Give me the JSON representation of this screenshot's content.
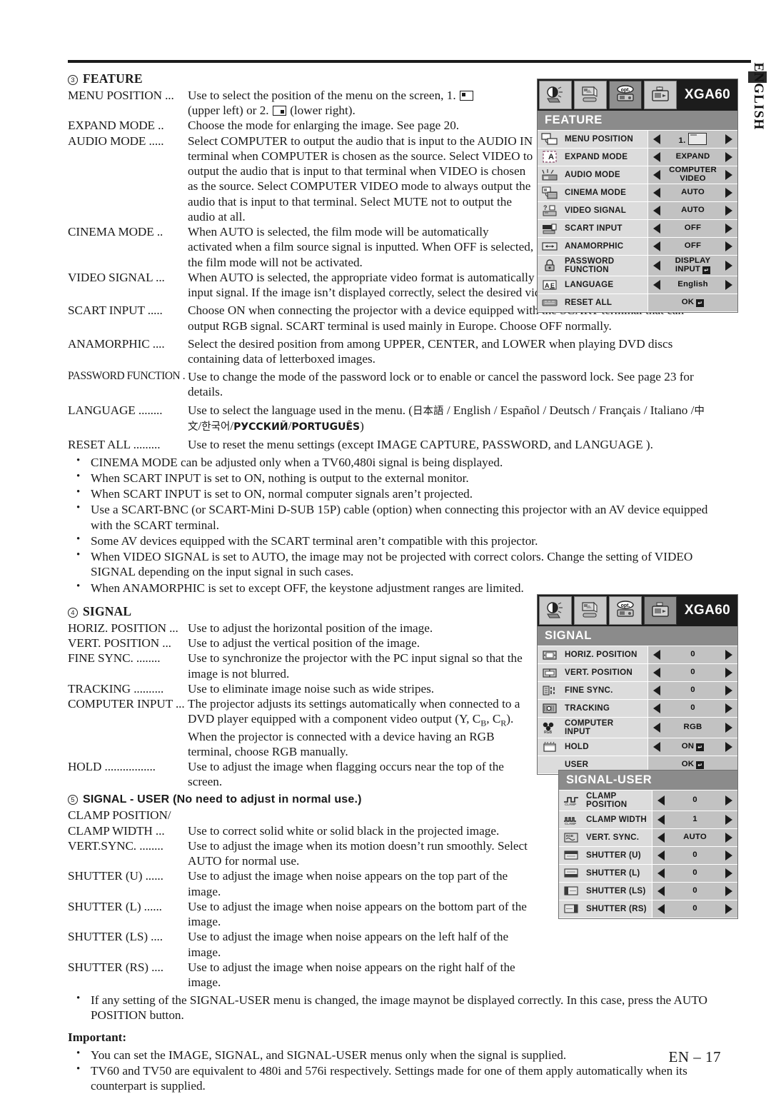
{
  "page": {
    "footer": "EN – 17",
    "side_tab_label": "ENGLISH"
  },
  "sections": {
    "feature": {
      "number": "3",
      "title": "FEATURE",
      "items": [
        {
          "term": "MENU POSITION ...",
          "desc_pre": "Use to select the position of the menu on the screen,  1.",
          "desc_mid": "(upper left) or 2.",
          "desc_post": "(lower right)."
        },
        {
          "term": "EXPAND MODE ..",
          "desc": "Choose the mode for enlarging the image. See page 20."
        },
        {
          "term": "AUDIO MODE .....",
          "desc": "Select COMPUTER to output the audio that is input to the AUDIO IN terminal when COMPUTER is chosen as the source. Select VIDEO to output the audio that is input to that terminal when VIDEO is chosen as the source. Select COMPUTER VIDEO mode to always output the audio that is input to that terminal. Select MUTE not to output the audio at all."
        },
        {
          "term": "CINEMA MODE ..",
          "desc": "When AUTO is selected, the film mode will be automatically activated when a film source signal is inputted. When OFF is selected, the film mode will not be activated."
        },
        {
          "term": "VIDEO SIGNAL ...",
          "desc": "When AUTO is selected, the appropriate video format is automatically selected depending on the input signal. If the image isn’t displayed correctly, select the desired video format manually."
        },
        {
          "term": "SCART INPUT .....",
          "desc": "Choose ON when connecting the projector with a device equipped with the SCART terminal that can output RGB signal. SCART terminal is used mainly in Europe. Choose OFF normally."
        },
        {
          "term": "ANAMORPHIC ....",
          "desc": "Select the desired position from among UPPER, CENTER, and LOWER when playing DVD discs containing data of letterboxed images."
        },
        {
          "term": "PASSWORD FUNCTION .",
          "desc": "Use to change the mode of the password lock or to enable or cancel the password lock. See page 23 for details."
        },
        {
          "term": "LANGUAGE ........",
          "desc_a": "Use to select the language used in the menu. (",
          "lang_jp": "日本語",
          "desc_b": " / English / Español / Deutsch / Français / Italiano /",
          "lang_cn": "中文",
          "lang_kr": "한국어",
          "lang_ru": "РУССКИЙ",
          "lang_pt": "PORTUGUÊS",
          "desc_c": ")"
        },
        {
          "term": "RESET ALL .........",
          "desc": "Use to reset the menu settings (except IMAGE CAPTURE, PASSWORD, and LANGUAGE )."
        }
      ],
      "bullets": [
        "CINEMA MODE can be adjusted only when a TV60,480i signal is being displayed.",
        "When SCART INPUT is set to ON, nothing is output to the external monitor.",
        "When SCART INPUT is set to ON, normal computer signals aren’t projected.",
        "Use a SCART-BNC (or SCART-Mini D-SUB 15P) cable (option) when connecting this projector with an AV device equipped with the SCART terminal.",
        "Some AV devices equipped with the SCART terminal aren’t compatible with this projector.",
        "When VIDEO SIGNAL is set to AUTO, the image may not be projected with correct colors. Change the setting of VIDEO SIGNAL depending on the input signal in such cases.",
        "When ANAMORPHIC is set to except OFF, the keystone adjustment ranges are limited."
      ]
    },
    "signal": {
      "number": "4",
      "title": "SIGNAL",
      "items": [
        {
          "term": "HORIZ. POSITION ...",
          "desc": "Use to adjust the horizontal position of the image."
        },
        {
          "term": "VERT. POSITION  ...",
          "desc": "Use to adjust the vertical position of the image."
        },
        {
          "term": "FINE SYNC. ........",
          "desc": "Use to synchronize the projector with the PC input signal so that the image is not blurred."
        },
        {
          "term": "TRACKING ..........",
          "desc": "Use to eliminate image noise such as wide stripes."
        },
        {
          "term": "COMPUTER INPUT ...",
          "desc_a": "The projector adjusts its settings automatically when connected to a DVD player equipped with a component video output (Y, C",
          "sub1": "B",
          "desc_b": ", C",
          "sub2": "R",
          "desc_c": "). When the projector is connected with a device having an RGB terminal, choose RGB manually."
        },
        {
          "term": "HOLD .................",
          "desc": "Use to adjust the image when flagging occurs near the top of the screen."
        }
      ]
    },
    "signal_user": {
      "number": "5",
      "title": "SIGNAL - USER (No need to adjust in normal use.)",
      "items": [
        {
          "term": "CLAMP POSITION/",
          "desc": ""
        },
        {
          "term": "CLAMP WIDTH ...",
          "desc": "Use to correct solid white or solid black in the projected image."
        },
        {
          "term": "VERT.SYNC. ........",
          "desc": "Use to adjust the image when its motion doesn’t run smoothly. Select AUTO for normal use."
        },
        {
          "term": "SHUTTER (U) ......",
          "desc": "Use to adjust the image when noise appears on the top part of the image."
        },
        {
          "term": "SHUTTER (L) ......",
          "desc": "Use to adjust the image when noise appears on the bottom part of the image."
        },
        {
          "term": "SHUTTER (LS) ....",
          "desc": "Use to adjust the image when noise appears on the left half of the image."
        },
        {
          "term": "SHUTTER (RS) ....",
          "desc": "Use to adjust the image when noise appears on the right half of the image."
        }
      ],
      "bullets": [
        "If any setting of the SIGNAL-USER menu is changed, the image maynot be displayed correctly. In this case, press the AUTO POSITION button."
      ]
    },
    "important": {
      "title": "Important:",
      "bullets": [
        "You can set the IMAGE, SIGNAL, and SIGNAL-USER menus only when the signal is supplied.",
        "TV60 and TV50 are equivalent to 480i and 576i respectively. Settings made for one of them apply automatically when its counterpart is supplied."
      ]
    }
  },
  "osd": {
    "feature": {
      "source_label": "XGA60",
      "menu_title": "FEATURE",
      "selected_tab_index": 2,
      "rows": [
        {
          "label": "MENU POSITION",
          "value": "1.",
          "icon": "menu-position-icon",
          "has_arrows": true,
          "has_glyph": true
        },
        {
          "label": "EXPAND MODE",
          "value": "EXPAND",
          "icon": "expand-mode-icon",
          "has_arrows": true
        },
        {
          "label": "AUDIO MODE",
          "value": "COMPUTER",
          "value2": "VIDEO",
          "icon": "audio-mode-icon",
          "has_arrows": true
        },
        {
          "label": "CINEMA MODE",
          "value": "AUTO",
          "icon": "cinema-mode-icon",
          "has_arrows": true
        },
        {
          "label": "VIDEO SIGNAL",
          "value": "AUTO",
          "icon": "video-signal-icon",
          "has_arrows": true
        },
        {
          "label": "SCART INPUT",
          "value": "OFF",
          "icon": "scart-input-icon",
          "has_arrows": true
        },
        {
          "label": "ANAMORPHIC",
          "value": "OFF",
          "icon": "anamorphic-icon",
          "has_arrows": true
        },
        {
          "label": "PASSWORD",
          "label2": "FUNCTION",
          "value": "DISPLAY",
          "value2": "INPUT",
          "icon": "password-lock-icon",
          "has_arrows": true,
          "enter": true
        },
        {
          "label": "LANGUAGE",
          "value": "English",
          "icon": "language-icon",
          "has_arrows": true
        },
        {
          "label": "RESET ALL",
          "value": "OK",
          "icon": "reset-all-icon",
          "has_arrows": false,
          "enter": true
        }
      ]
    },
    "signal": {
      "source_label": "XGA60",
      "menu_title": "SIGNAL",
      "selected_tab_index": 3,
      "rows": [
        {
          "label": "HORIZ. POSITION",
          "value": "0",
          "icon": "horiz-position-icon",
          "has_arrows": true
        },
        {
          "label": "VERT. POSITION",
          "value": "0",
          "icon": "vert-position-icon",
          "has_arrows": true
        },
        {
          "label": "FINE SYNC.",
          "value": "0",
          "icon": "fine-sync-icon",
          "has_arrows": true
        },
        {
          "label": "TRACKING",
          "value": "0",
          "icon": "tracking-icon",
          "has_arrows": true
        },
        {
          "label": "COMPUTER",
          "label2": "INPUT",
          "value": "RGB",
          "icon": "computer-input-icon",
          "has_arrows": true
        },
        {
          "label": "HOLD",
          "value": "ON",
          "icon": "hold-icon",
          "has_arrows": true,
          "enter": true
        },
        {
          "label": "USER",
          "value": "OK",
          "icon": "",
          "has_arrows": false,
          "enter": true
        }
      ]
    },
    "signal_user": {
      "menu_title": "SIGNAL-USER",
      "rows": [
        {
          "label": "CLAMP",
          "label2": "POSITION",
          "value": "0",
          "icon": "clamp-position-icon",
          "has_arrows": true
        },
        {
          "label": "CLAMP WIDTH",
          "value": "1",
          "icon": "clamp-width-icon",
          "has_arrows": true
        },
        {
          "label": "VERT. SYNC.",
          "value": "AUTO",
          "icon": "vert-sync-icon",
          "has_arrows": true
        },
        {
          "label": "SHUTTER (U)",
          "value": "0",
          "icon": "shutter-u-icon",
          "has_arrows": true
        },
        {
          "label": "SHUTTER (L)",
          "value": "0",
          "icon": "shutter-l-icon",
          "has_arrows": true
        },
        {
          "label": "SHUTTER (LS)",
          "value": "0",
          "icon": "shutter-ls-icon",
          "has_arrows": true
        },
        {
          "label": "SHUTTER (RS)",
          "value": "0",
          "icon": "shutter-rs-icon",
          "has_arrows": true
        }
      ]
    },
    "tabs": [
      {
        "name": "image-tab",
        "glyph": "contrast"
      },
      {
        "name": "picture-tab",
        "glyph": "picture"
      },
      {
        "name": "option-tab",
        "glyph": "opt"
      },
      {
        "name": "signal-tab",
        "glyph": "signal"
      }
    ],
    "colors": {
      "header_bg": "#1c1c1c",
      "title_bar": "#8b8b8b",
      "row_bg": "#dcdcdc",
      "value_bg": "#c2c2c2",
      "text": "#1b1b1b"
    }
  }
}
